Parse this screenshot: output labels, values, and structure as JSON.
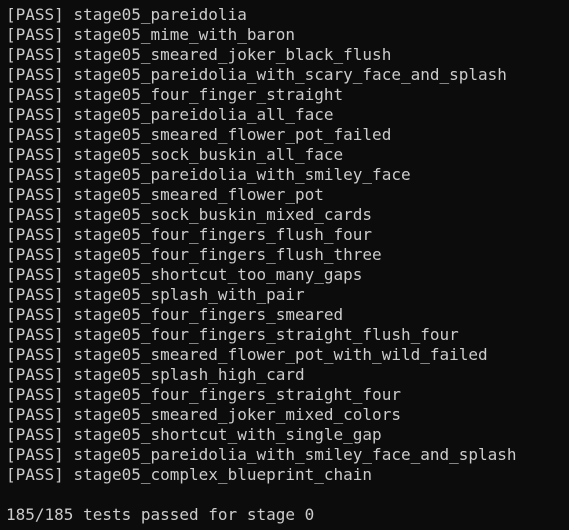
{
  "tests": [
    {
      "status": "[PASS]",
      "name": "stage05_pareidolia"
    },
    {
      "status": "[PASS]",
      "name": "stage05_mime_with_baron"
    },
    {
      "status": "[PASS]",
      "name": "stage05_smeared_joker_black_flush"
    },
    {
      "status": "[PASS]",
      "name": "stage05_pareidolia_with_scary_face_and_splash"
    },
    {
      "status": "[PASS]",
      "name": "stage05_four_finger_straight"
    },
    {
      "status": "[PASS]",
      "name": "stage05_pareidolia_all_face"
    },
    {
      "status": "[PASS]",
      "name": "stage05_smeared_flower_pot_failed"
    },
    {
      "status": "[PASS]",
      "name": "stage05_sock_buskin_all_face"
    },
    {
      "status": "[PASS]",
      "name": "stage05_pareidolia_with_smiley_face"
    },
    {
      "status": "[PASS]",
      "name": "stage05_smeared_flower_pot"
    },
    {
      "status": "[PASS]",
      "name": "stage05_sock_buskin_mixed_cards"
    },
    {
      "status": "[PASS]",
      "name": "stage05_four_fingers_flush_four"
    },
    {
      "status": "[PASS]",
      "name": "stage05_four_fingers_flush_three"
    },
    {
      "status": "[PASS]",
      "name": "stage05_shortcut_too_many_gaps"
    },
    {
      "status": "[PASS]",
      "name": "stage05_splash_with_pair"
    },
    {
      "status": "[PASS]",
      "name": "stage05_four_fingers_smeared"
    },
    {
      "status": "[PASS]",
      "name": "stage05_four_fingers_straight_flush_four"
    },
    {
      "status": "[PASS]",
      "name": "stage05_smeared_flower_pot_with_wild_failed"
    },
    {
      "status": "[PASS]",
      "name": "stage05_splash_high_card"
    },
    {
      "status": "[PASS]",
      "name": "stage05_four_fingers_straight_four"
    },
    {
      "status": "[PASS]",
      "name": "stage05_smeared_joker_mixed_colors"
    },
    {
      "status": "[PASS]",
      "name": "stage05_shortcut_with_single_gap"
    },
    {
      "status": "[PASS]",
      "name": "stage05_pareidolia_with_smiley_face_and_splash"
    },
    {
      "status": "[PASS]",
      "name": "stage05_complex_blueprint_chain"
    }
  ],
  "summary": "185/185 tests passed for stage 0",
  "colors": {
    "background": "#0c0c0c",
    "text": "#cccccc"
  }
}
